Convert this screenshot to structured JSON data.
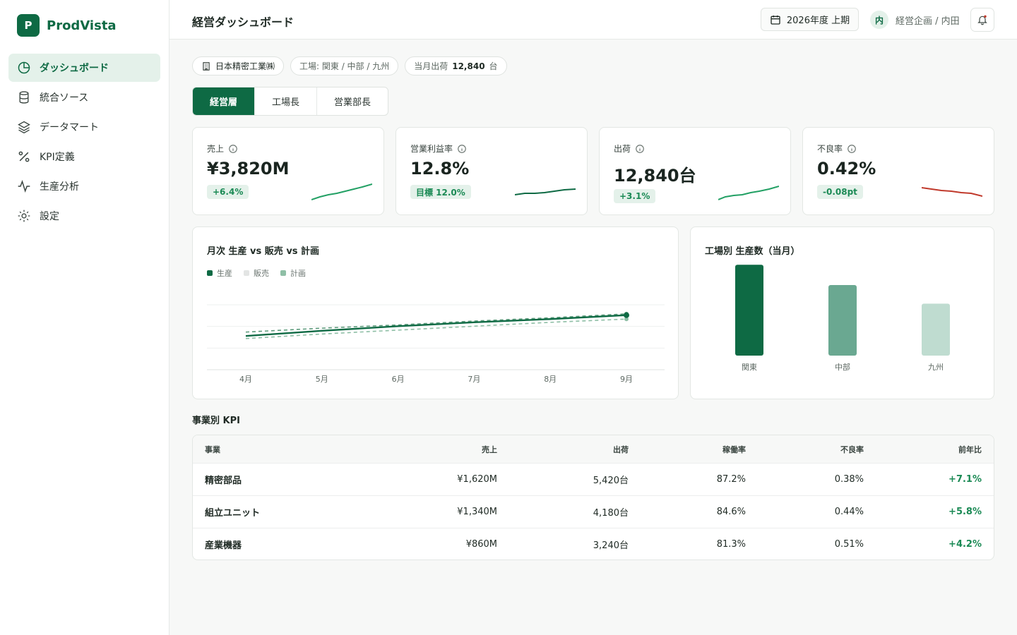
{
  "brand": {
    "logo_letter": "P",
    "name": "ProdVista"
  },
  "nav": [
    {
      "label": "ダッシュボード",
      "icon": "pie-chart-icon",
      "active": true
    },
    {
      "label": "統合ソース",
      "icon": "database-icon",
      "active": false
    },
    {
      "label": "データマート",
      "icon": "layers-icon",
      "active": false
    },
    {
      "label": "KPI定義",
      "icon": "percent-icon",
      "active": false
    },
    {
      "label": "生産分析",
      "icon": "activity-icon",
      "active": false
    },
    {
      "label": "設定",
      "icon": "gear-icon",
      "active": false
    }
  ],
  "header": {
    "title": "経営ダッシュボード",
    "period": "2026年度 上期",
    "user_initial": "内",
    "user_name": "経営企画 / 内田"
  },
  "chips": {
    "company": "日本精密工業㈱",
    "factories": "工場: 関東 / 中部 / 九州",
    "shipment_label": "当月出荷",
    "shipment_value": "12,840",
    "shipment_unit": "台"
  },
  "tabs": [
    "経営層",
    "工場長",
    "営業部長"
  ],
  "kpis": [
    {
      "label": "売上",
      "value": "¥3,820M",
      "badge": "+6.4%",
      "trend": "up",
      "color": "#22a064"
    },
    {
      "label": "営業利益率",
      "value": "12.8%",
      "badge": "目標 12.0%",
      "trend": "up",
      "color": "#0e6a44"
    },
    {
      "label": "出荷",
      "value": "12,840台",
      "badge": "+3.1%",
      "trend": "up",
      "color": "#22a064"
    },
    {
      "label": "不良率",
      "value": "0.42%",
      "badge": "-0.08pt",
      "trend": "down",
      "color": "#c0392b"
    }
  ],
  "colors": {
    "accent": "#0e6a44",
    "positive": "#1b8a55",
    "negative": "#c0392b"
  },
  "line_chart": {
    "title": "月次 生産 vs 販売 vs 計画",
    "legend": [
      {
        "name": "生産",
        "color": "#0e6a44"
      },
      {
        "name": "販売",
        "color": "#e3e5e4"
      },
      {
        "name": "計画",
        "color": "#8fbfa6"
      }
    ]
  },
  "bar_chart": {
    "title": "工場別 生産数（当月）"
  },
  "chart_data": [
    {
      "type": "line",
      "x": [
        "4月",
        "5月",
        "6月",
        "7月",
        "8月",
        "9月"
      ],
      "ylim": [
        0,
        100
      ],
      "series": [
        {
          "name": "生産",
          "values": [
            52,
            60,
            67,
            73,
            78,
            84
          ],
          "color": "#0e6a44"
        },
        {
          "name": "販売",
          "values": [
            58,
            64,
            69,
            75,
            80,
            86
          ],
          "color": "#5d9b7c"
        },
        {
          "name": "計画",
          "values": [
            48,
            55,
            61,
            67,
            73,
            78
          ],
          "color": "#8fbfa6"
        }
      ]
    },
    {
      "type": "bar",
      "categories": [
        "関東",
        "中部",
        "九州"
      ],
      "values": [
        5600,
        4350,
        3200
      ],
      "ylim": [
        0,
        6000
      ],
      "colors": [
        "#0e6a44",
        "#6aa891",
        "#bfdcd0"
      ]
    }
  ],
  "table_section_title": "事業別 KPI",
  "table": {
    "headers": [
      "事業",
      "売上",
      "出荷",
      "稼働率",
      "不良率",
      "前年比"
    ],
    "rows": [
      [
        "精密部品",
        "¥1,620M",
        "5,420台",
        "87.2%",
        "0.38%",
        "+7.1%"
      ],
      [
        "組立ユニット",
        "¥1,340M",
        "4,180台",
        "84.6%",
        "0.44%",
        "+5.8%"
      ],
      [
        "産業機器",
        "¥860M",
        "3,240台",
        "81.3%",
        "0.51%",
        "+4.2%"
      ]
    ]
  }
}
